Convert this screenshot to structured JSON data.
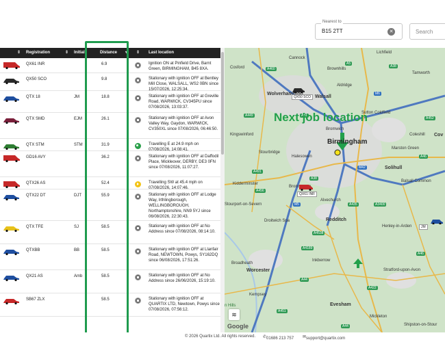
{
  "search_bar": {
    "nearest_label": "Nearest to",
    "nearest_value": "B15 2TT",
    "search_placeholder": "Search"
  },
  "table": {
    "columns": [
      "Registration",
      "Initials",
      "Distance",
      "Last location"
    ],
    "rows": [
      {
        "vehicle": "van-red",
        "registration": "QX61 INR",
        "initials": "",
        "distance": "6.9",
        "status": "stopped",
        "location": "Ignition ON at Pinfield Drive, Barnt Green, BIRMINGHAM, B45 8XA."
      },
      {
        "vehicle": "car-black",
        "registration": "QX50 SCO",
        "initials": "",
        "distance": "9.8",
        "status": "stopped",
        "location": "Stationary with ignition OFF at Bentley Mill Close, WALSALL, WS2 0BN since 15/07/2026, 12:25:34."
      },
      {
        "vehicle": "car-blue",
        "registration": "QTX 18",
        "initials": "JM",
        "distance": "18.8",
        "status": "stopped",
        "location": "Stationary with ignition OFF at Greville Road, WARWICK, CV345PU since 07/08/2026, 13:03:37."
      },
      {
        "vehicle": "car-maroon",
        "registration": "QTX SMD",
        "initials": "EJM",
        "distance": "26.1",
        "status": "stopped",
        "location": "Stationary with ignition OFF at Avon Valley Way, Gaydon, WARWICK, CV350XL since 07/08/2026, 06:46:50."
      },
      {
        "vehicle": "car-green",
        "registration": "QTX STM",
        "initials": "STM",
        "distance": "31.9",
        "status": "moving-green",
        "location": "Travelling E at 24.9 mph on 07/08/2026, 14:08:41."
      },
      {
        "vehicle": "van-red",
        "registration": "GD16 AVY",
        "initials": "",
        "distance": "36.2",
        "status": "stopped",
        "location": "Stationary with ignition OFF at Daffodil Place, Mickleover, DERBY, DE3 0FN since 07/08/2026, 11:07:27."
      },
      {
        "vehicle": "van-red-small",
        "registration": "QTX26 AS",
        "initials": "",
        "distance": "52.4",
        "status": "moving-yellow",
        "location": "Travelling SW at 45.4 mph on 07/08/2026, 14:07:46."
      },
      {
        "vehicle": "car-blue",
        "registration": "QTX22 DT",
        "initials": "DJT",
        "distance": "55.9",
        "status": "stopped",
        "location": "Stationary with ignition OFF at Lodge Way, Irthlingborough, WELLINGBOROUGH, Northamptonshire, NN9 5YJ since 06/08/2026, 22:30:43."
      },
      {
        "vehicle": "car-yellow",
        "registration": "QTX TFE",
        "initials": "SJ",
        "distance": "58.5",
        "status": "stopped",
        "location": "Stationary with ignition OFF at No Address since 07/08/2026, 08:14:10."
      },
      {
        "vehicle": "car-blue",
        "registration": "QTXBB",
        "initials": "BB",
        "distance": "58.5",
        "status": "stopped",
        "location": "Stationary with ignition OFF at Llanfair Road, NEWTOWN, Powys, SY162DQ since 06/08/2026, 17:51:26."
      },
      {
        "vehicle": "car-blue",
        "registration": "QX21 AS",
        "initials": "Amb",
        "distance": "58.5",
        "status": "stopped",
        "location": "Stationary with ignition OFF at No Address since 26/06/2026, 15:19:10."
      },
      {
        "vehicle": "car-red",
        "registration": "SB67 ZLX",
        "initials": "",
        "distance": "58.5",
        "status": "stopped",
        "location": "Stationary with ignition OFF at QUARTIX LTD, Newtown, Powys since 07/08/2026, 07:56:12."
      }
    ]
  },
  "map": {
    "annotation": "Next job location",
    "places": {
      "cosford": "Cosford",
      "cannock": "Cannock",
      "brownhills": "Brownhills",
      "lichfield": "Lichfield",
      "tamworth": "Tamworth",
      "wolverhampton": "Wolverhampton",
      "walsall": "Walsall",
      "aldridge": "Aldridge",
      "sutton": "Sutton Coldfield",
      "bromwich": "Bromwich",
      "kingswinford": "Kingswinford",
      "birmingham": "Birmingham",
      "coleshill": "Coleshill",
      "stourbridge": "Stourbridge",
      "halesowen": "Halesowen",
      "marston": "Marston Green",
      "solihull": "Solihull",
      "kidderminster": "Kidderminster",
      "bromsgrove": "Bromsgrove",
      "alvechurch": "Alvechurch",
      "balsall": "Balsall Common",
      "stourport": "Stourport-on-Severn",
      "redditch": "Redditch",
      "henley": "Henley-in-Arden",
      "droitwich": "Droitwich Spa",
      "broadheath": "Broadheath",
      "worcester": "Worcester",
      "inkberrow": "Inkberrow",
      "stratford": "Stratford-upon-Avon",
      "kempsey": "Kempsey",
      "evesham": "Evesham",
      "mickleton": "Mickleton",
      "shipston": "Shipston-on-Stour",
      "hills": "n Hills",
      "coventry": "Cov"
    },
    "tags": {
      "walsall_car": "QX50 SCO",
      "redditch_van": "QX61 INR",
      "east_car": "JM"
    },
    "roads": [
      "A460",
      "A5",
      "A38",
      "M6",
      "A452",
      "A449",
      "A41",
      "A491",
      "A456",
      "A38",
      "M5",
      "A435",
      "A46",
      "A4189",
      "A44",
      "A422",
      "A46",
      "M42",
      "A3400",
      "A44",
      "A4538",
      "A451"
    ]
  },
  "footer": {
    "copyright": "© 2026 Quartix Ltd. All rights reserved.",
    "phone": "01686 213 757",
    "email": "support@quartix.com"
  },
  "colors": {
    "highlight": "#1f9b4e",
    "header": "#222222"
  }
}
